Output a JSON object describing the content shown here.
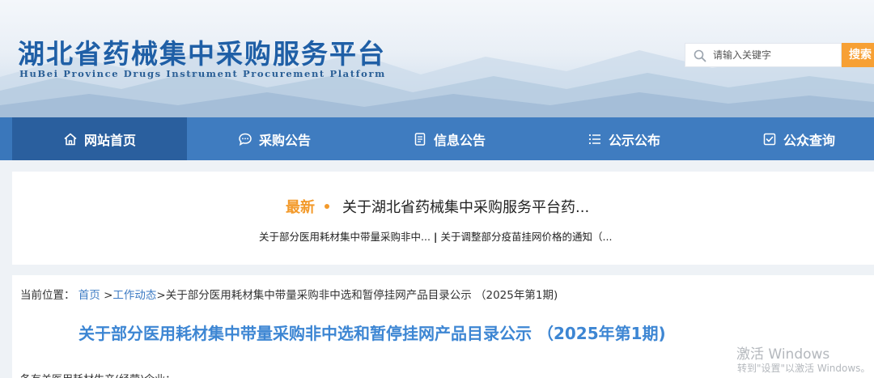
{
  "header": {
    "title": "湖北省药械集中采购服务平台",
    "subtitle": "HuBei Province Drugs Instrument Procurement Platform"
  },
  "search": {
    "placeholder": "请输入关键字",
    "button_label": "搜索"
  },
  "nav": {
    "items": [
      {
        "label": "网站首页",
        "icon": "home-icon",
        "active": true
      },
      {
        "label": "采购公告",
        "icon": "chat-bubble-icon",
        "active": false
      },
      {
        "label": "信息公告",
        "icon": "document-icon",
        "active": false
      },
      {
        "label": "公示公布",
        "icon": "list-icon",
        "active": false
      },
      {
        "label": "公众查询",
        "icon": "checkbox-icon",
        "active": false
      }
    ]
  },
  "notice": {
    "latest_label": "最新",
    "headline": "关于湖北省药械集中采购服务平台药...",
    "links": [
      "关于部分医用耗材集中带量采购非中...",
      "关于调整部分疫苗挂网价格的通知（..."
    ],
    "separator": "|"
  },
  "breadcrumb": {
    "prefix": "当前位置：",
    "home": "首页",
    "arrow": ">",
    "section": "工作动态",
    "current": "关于部分医用耗材集中带量采购非中选和暂停挂网产品目录公示 （2025年第1期)"
  },
  "article": {
    "title": "关于部分医用耗材集中带量采购非中选和暂停挂网产品目录公示 （2025年第1期)",
    "body_first_line": "各有关医用耗材生产(经营)企业："
  },
  "watermark": {
    "line1": "激活 Windows",
    "line2": "转到\"设置\"以激活 Windows。"
  },
  "colors": {
    "brand_blue": "#3f7cc0",
    "nav_active": "#2a5f9e",
    "accent_orange": "#f7a034",
    "link_blue": "#3d7bc4"
  }
}
